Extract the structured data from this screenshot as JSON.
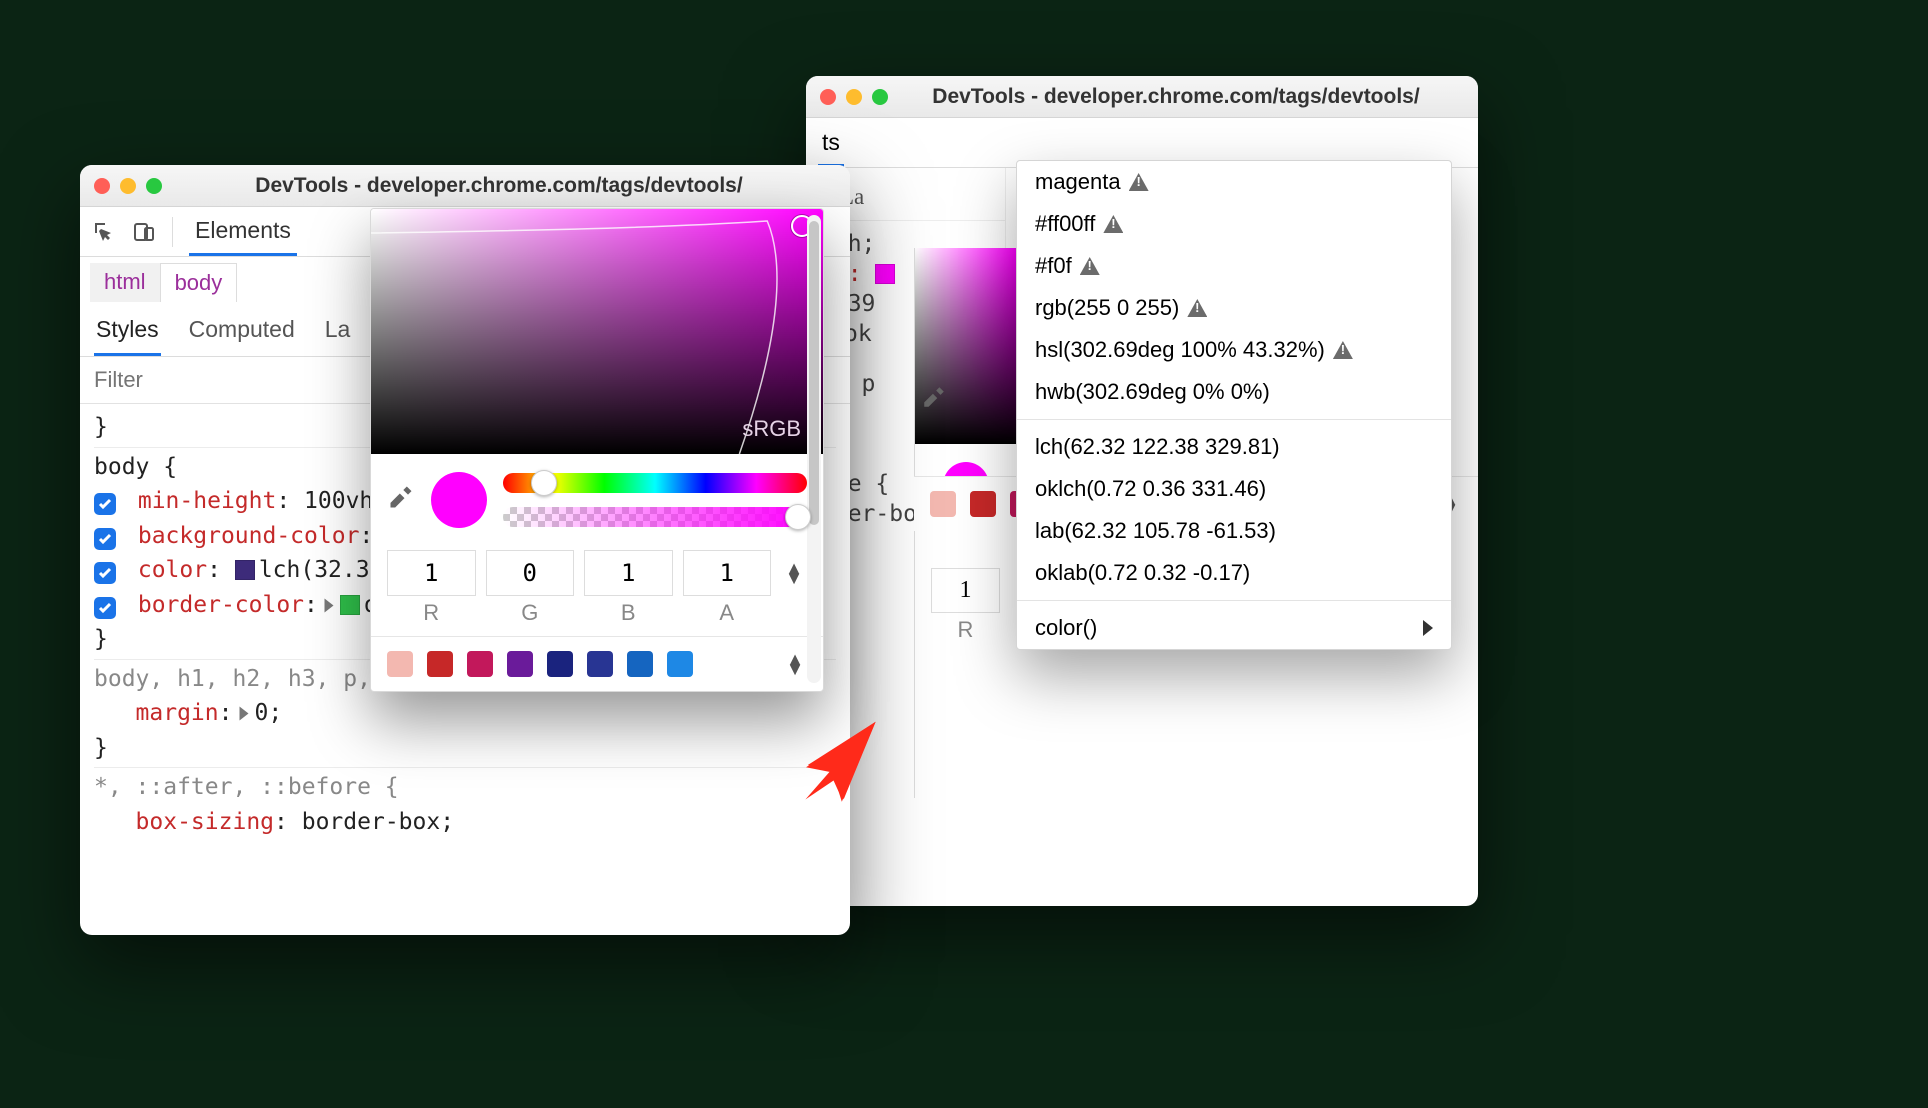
{
  "windows": {
    "front": {
      "title": "DevTools - developer.chrome.com/tags/devtools/",
      "tab": "Elements",
      "breadcrumb": [
        "html",
        "body"
      ],
      "subtabs": [
        "Styles",
        "Computed",
        "La"
      ],
      "filter_placeholder": "Filter",
      "rules": {
        "body": {
          "selector": "body {",
          "props": [
            {
              "name": "min-height",
              "value": "100vh;"
            },
            {
              "name": "background-color",
              "value": "",
              "swatch": "#ff00ff"
            },
            {
              "name": "color",
              "value": "lch(32.39 ",
              "swatch": "#3d2b7a"
            },
            {
              "name": "border-color",
              "value": "ok",
              "swatch": "#2fbf4a",
              "expander": true
            }
          ],
          "close": "}"
        },
        "group": {
          "selector": "body, h1, h2, h3, p, p",
          "prop": {
            "name": "margin",
            "value": "0;",
            "expander": true
          },
          "close": "}"
        },
        "star": {
          "selector": "*, ::after, ::before {",
          "prop": {
            "name": "box-sizing",
            "value": "border-box;"
          }
        }
      }
    },
    "back": {
      "title": "DevTools - developer.chrome.com/tags/devtools/",
      "tab_trunc": "​ts",
      "subtab": "La",
      "lines": {
        "l1": "0vh;",
        "l2_prop": "or:",
        "l2_swatch": "#ff00ff",
        "l3": "2.39 ",
        "l3_swatch": "#3d2b7a",
        "l4_swatch": "#2fbf4a",
        "l4": "ok",
        "l5": "p, p",
        "l6": "ore {",
        "l7": "rder-box;"
      },
      "numbox": "1",
      "lblR": "R"
    }
  },
  "picker": {
    "space_label": "sRGB",
    "rgba": {
      "R": "1",
      "G": "0",
      "B": "1",
      "A": "1"
    },
    "labels": [
      "R",
      "G",
      "B",
      "A"
    ],
    "palette": [
      "#f3b8b0",
      "#c62828",
      "#c2185b",
      "#6a1b9a",
      "#1a237e",
      "#283593",
      "#1565c0",
      "#1e88e5"
    ]
  },
  "menu": {
    "items_warn": [
      "magenta",
      "#ff00ff",
      "#f0f",
      "rgb(255 0 255)",
      "hsl(302.69deg 100% 43.32%)"
    ],
    "item_hwb": "hwb(302.69deg 0% 0%)",
    "items_plain": [
      "lch(62.32 122.38 329.81)",
      "oklch(0.72 0.36 331.46)",
      "lab(62.32 105.78 -61.53)",
      "oklab(0.72 0.32 -0.17)"
    ],
    "submenu": "color()"
  },
  "back_palette": [
    "#f3b8b0",
    "#c62828",
    "#c2185b",
    "#6a1b9a",
    "#1a237e",
    "#283593",
    "#1565c0",
    "#1e88e5"
  ]
}
